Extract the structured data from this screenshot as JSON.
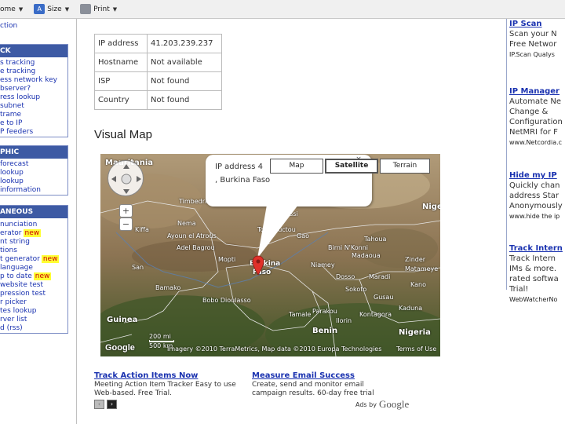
{
  "toolbar": {
    "home_label": "ome",
    "size_label": "Size",
    "print_label": "Print"
  },
  "sidebar": {
    "top_items": [
      "ction"
    ],
    "sections": [
      {
        "header": "CK",
        "items": [
          "s tracking",
          "e tracking",
          "ess network key",
          "bserver?",
          "ress lookup",
          "subnet",
          "trame",
          "e to IP",
          "P feeders"
        ]
      },
      {
        "header": "PHIC",
        "items": [
          "forecast",
          "lookup",
          "lookup",
          "information"
        ]
      },
      {
        "header": "ANEOUS",
        "items": [
          {
            "label": "nunciation",
            "new": false
          },
          {
            "label": "erator",
            "new": true
          },
          {
            "label": "nt string",
            "new": false
          },
          {
            "label": "tions",
            "new": false
          },
          {
            "label": "t generator",
            "new": true
          },
          {
            "label": "language",
            "new": false
          },
          {
            "label": "p to date",
            "new": true
          },
          {
            "label": "website test",
            "new": false
          },
          {
            "label": "pression test",
            "new": false
          },
          {
            "label": "r picker",
            "new": false
          },
          {
            "label": "tes lookup",
            "new": false
          },
          {
            "label": "rver list",
            "new": false
          },
          {
            "label": "d (rss)",
            "new": false
          }
        ]
      }
    ],
    "new_badge": "new"
  },
  "info_table": {
    "rows": [
      {
        "label": "IP address",
        "value": "41.203.239.237"
      },
      {
        "label": "Hostname",
        "value": "Not available"
      },
      {
        "label": "ISP",
        "value": "Not found"
      },
      {
        "label": "Country",
        "value": "Not found"
      }
    ]
  },
  "map_section": {
    "title": "Visual Map",
    "bubble_line1": "IP address 4",
    "bubble_line2": ", Burkina Faso",
    "map_types": [
      "Map",
      "Satellite",
      "Terrain"
    ],
    "active_map_type": "Satellite",
    "scale_top": "200 mi",
    "scale_bottom": "500 km",
    "attribution": "Imagery ©2010 TerraMetrics, Map data ©2010 Europa Technologies",
    "terms": "Terms of Use",
    "zoom_in": "+",
    "zoom_out": "−",
    "google": "Google",
    "labels": {
      "mauritania": "Mauritania",
      "burkina": "Burkina",
      "faso": "Faso",
      "niger": "Nige",
      "nigeria": "Nigeria",
      "guinea": "Guinea",
      "benin": "Benin",
      "niamey": "Niamey",
      "maradi": "Maradi",
      "zinder": "Zinder",
      "kano": "Kano",
      "dosso": "Dosso",
      "mopti": "Mopti",
      "bamako": "Bamako",
      "nema": "Nema",
      "gao": "Gao",
      "tahoua": "Tahoua",
      "sokoto": "Sokoto",
      "parakou": "Parakou",
      "ouagadougou_near": "Bobo Dioulasso",
      "birni": "Birni N'Konni",
      "madaoua": "Madaoua",
      "matameye": "Matameye",
      "gusau": "Gusau",
      "kaduna": "Kaduna",
      "tamale": "Tamale",
      "ilorin": "Ilorin",
      "kontagora": "Kontagora",
      "mali_town": "Gossi",
      "tessalit": "Timbedra",
      "ayoun": "Ayoun el Atrous",
      "kiffa": "Kiffa",
      "adel": "Adel Bagrou",
      "tombouctou": "Tombouctou",
      "san": "San"
    }
  },
  "bottom_ads": [
    {
      "title": "Track Action Items Now",
      "line1": "Meeting Action Item Tracker Easy to use",
      "line2": "Web-based. Free Trial."
    },
    {
      "title": "Measure Email Success",
      "line1": "Create, send and monitor email",
      "line2": "campaign results. 60-day free trial"
    }
  ],
  "ads_by": "Ads by",
  "ads_google": "Google",
  "pager": {
    "prev": "‹",
    "next": "›"
  },
  "right_ads": [
    {
      "title": "IP Scan",
      "lines": [
        "Scan your N",
        "Free Networ"
      ],
      "url": "IP.Scan Qualys"
    },
    {
      "title": "IP Manager",
      "lines": [
        "Automate Ne",
        "Change &",
        "Configuration",
        "NetMRI for F"
      ],
      "url": "www.Netcordia.c"
    },
    {
      "title": "Hide my IP",
      "lines": [
        "Quickly chan",
        "address Star",
        "Anonymously"
      ],
      "url": "www.hide the ip"
    },
    {
      "title": "Track Intern",
      "lines": [
        "Track Intern",
        "IMs & more.",
        "rated softwa",
        "Trial!"
      ],
      "url": "WebWatcherNo"
    }
  ],
  "colors": {
    "link": "#1a32b0",
    "sidebar_header": "#3d5aa4",
    "new_badge_bg": "#ffff33",
    "map_marker": "#e0312a"
  }
}
